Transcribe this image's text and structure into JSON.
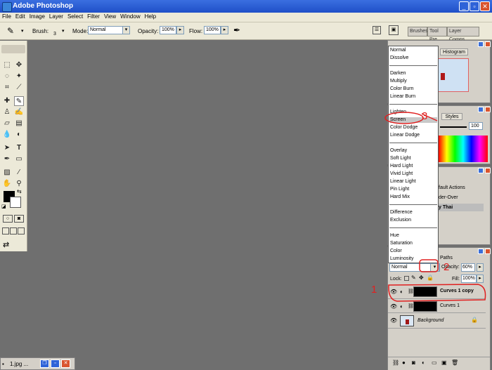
{
  "window": {
    "title": "Adobe Photoshop"
  },
  "menubar": {
    "items": [
      "File",
      "Edit",
      "Image",
      "Layer",
      "Select",
      "Filter",
      "View",
      "Window",
      "Help"
    ]
  },
  "options": {
    "brush_label": "Brush:",
    "brush_size": "3",
    "mode_label": "Mode:",
    "mode_value": "Normal",
    "opacity_label": "Opacity:",
    "opacity_value": "100%",
    "flow_label": "Flow:",
    "flow_value": "100%",
    "well_tabs": [
      "Brushes",
      "Tool Pre",
      "Layer Comps"
    ]
  },
  "panels": {
    "navigator_tab": "Histogram",
    "styles_tab": "Styles",
    "color_value": "100",
    "actions_items": [
      "fault Actions",
      "der-Over",
      "y Thai"
    ],
    "paths_tab": "Paths"
  },
  "blend_menu": {
    "groups": [
      [
        "Normal",
        "Dissolve"
      ],
      [
        "Darken",
        "Multiply",
        "Color Burn",
        "Linear Burn"
      ],
      [
        "Lighten",
        "Screen",
        "Color Dodge",
        "Linear Dodge"
      ],
      [
        "Overlay",
        "Soft Light",
        "Hard Light",
        "Vivid Light",
        "Linear Light",
        "Pin Light",
        "Hard Mix"
      ],
      [
        "Difference",
        "Exclusion"
      ],
      [
        "Hue",
        "Saturation",
        "Color",
        "Luminosity"
      ]
    ],
    "selected": "Screen"
  },
  "layers": {
    "mode_value": "Normal",
    "opacity_label": "Opacity:",
    "opacity_value": "60%",
    "lock_label": "Lock:",
    "fill_label": "Fill:",
    "fill_value": "100%",
    "rows": [
      {
        "name": "Curves 1 copy",
        "bold": true
      },
      {
        "name": "Curves 1",
        "bold": false
      },
      {
        "name": "Background",
        "italic": true
      }
    ]
  },
  "annotations": [
    "1",
    "2",
    "3"
  ],
  "taskbar": {
    "label": "1.jpg ..."
  },
  "colors": {
    "accent": "#e02020",
    "canvas": "#6f6f6f",
    "chrome": "#ece9d8",
    "panel": "#d4d0c8"
  }
}
